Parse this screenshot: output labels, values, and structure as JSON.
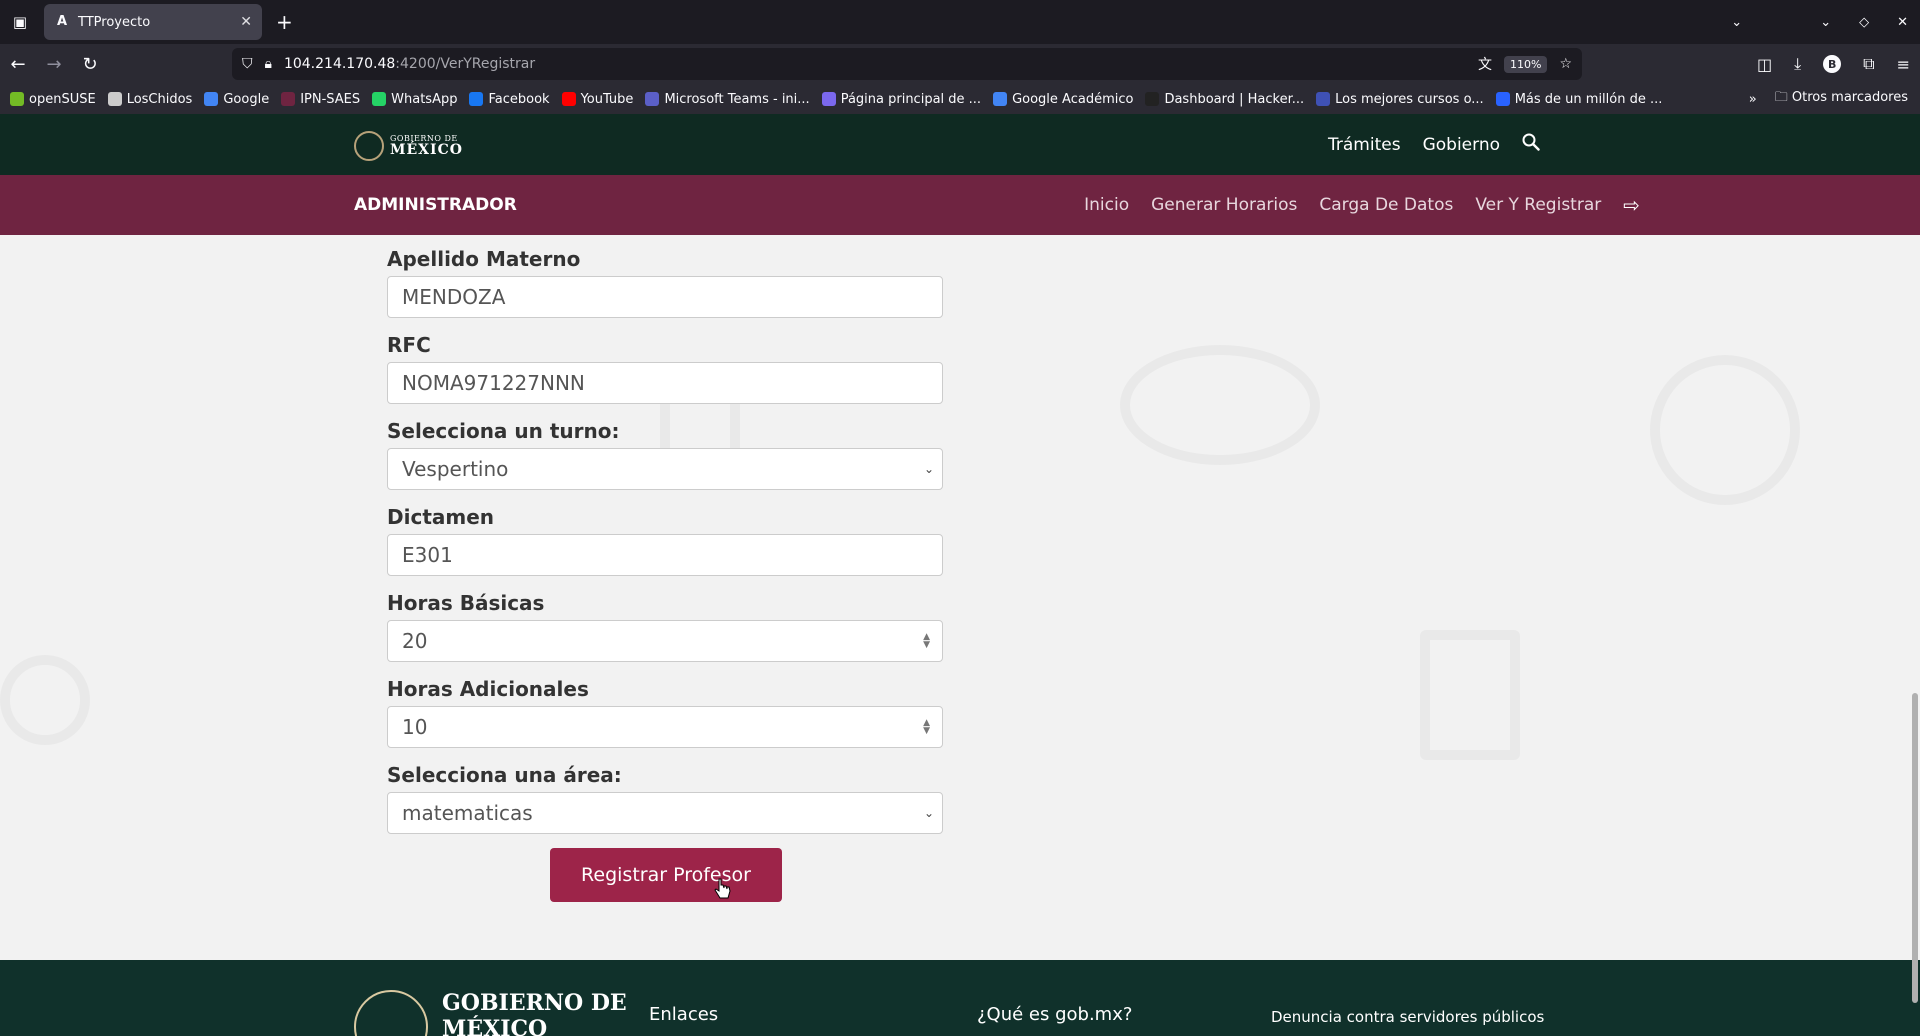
{
  "browser": {
    "tab_title": "TTProyecto",
    "tab_favicon": "A",
    "url_host": "104.214.170.48",
    "url_rest": ":4200/VerYRegistrar",
    "zoom": "110%",
    "bookmarks": [
      {
        "label": "openSUSE",
        "color": "#73ba25"
      },
      {
        "label": "LosChidos",
        "color": "#cccccc"
      },
      {
        "label": "Google",
        "color": "#4285f4"
      },
      {
        "label": "IPN-SAES",
        "color": "#6f2441"
      },
      {
        "label": "WhatsApp",
        "color": "#25d366"
      },
      {
        "label": "Facebook",
        "color": "#1877f2"
      },
      {
        "label": "YouTube",
        "color": "#ff0000"
      },
      {
        "label": "Microsoft Teams - ini...",
        "color": "#5b5fc7"
      },
      {
        "label": "Página principal de ...",
        "color": "#7b68ee"
      },
      {
        "label": "Google Académico",
        "color": "#4285f4"
      },
      {
        "label": "Dashboard | Hacker...",
        "color": "#222222"
      },
      {
        "label": "Los mejores cursos o...",
        "color": "#3f51b5"
      },
      {
        "label": "Más de un millón de ...",
        "color": "#2962ff"
      }
    ],
    "other_bookmarks": "Otros marcadores"
  },
  "gov_header": {
    "logo_line1": "GOBIERNO DE",
    "logo_line2": "MÉXICO",
    "links": [
      "Trámites",
      "Gobierno"
    ]
  },
  "admin_bar": {
    "title": "ADMINISTRADOR",
    "nav": [
      "Inicio",
      "Generar Horarios",
      "Carga De Datos",
      "Ver Y Registrar"
    ]
  },
  "form": {
    "apellido_materno_label": "Apellido Materno",
    "apellido_materno_value": "MENDOZA",
    "rfc_label": "RFC",
    "rfc_value": "NOMA971227NNN",
    "turno_label": "Selecciona un turno:",
    "turno_value": "Vespertino",
    "dictamen_label": "Dictamen",
    "dictamen_value": "E301",
    "horas_basicas_label": "Horas Básicas",
    "horas_basicas_value": "20",
    "horas_adicionales_label": "Horas Adicionales",
    "horas_adicionales_value": "10",
    "area_label": "Selecciona una área:",
    "area_value": "matematicas",
    "submit_label": "Registrar Profesor"
  },
  "footer": {
    "logo_line1": "GOBIERNO DE",
    "logo_line2": "MÉXICO",
    "col1": "Enlaces",
    "col2": "¿Qué es gob.mx?",
    "col3": "Denuncia contra servidores públicos"
  },
  "colors": {
    "gov_green": "#0f2a22",
    "admin_maroon": "#6f2441",
    "button": "#9d2449"
  }
}
